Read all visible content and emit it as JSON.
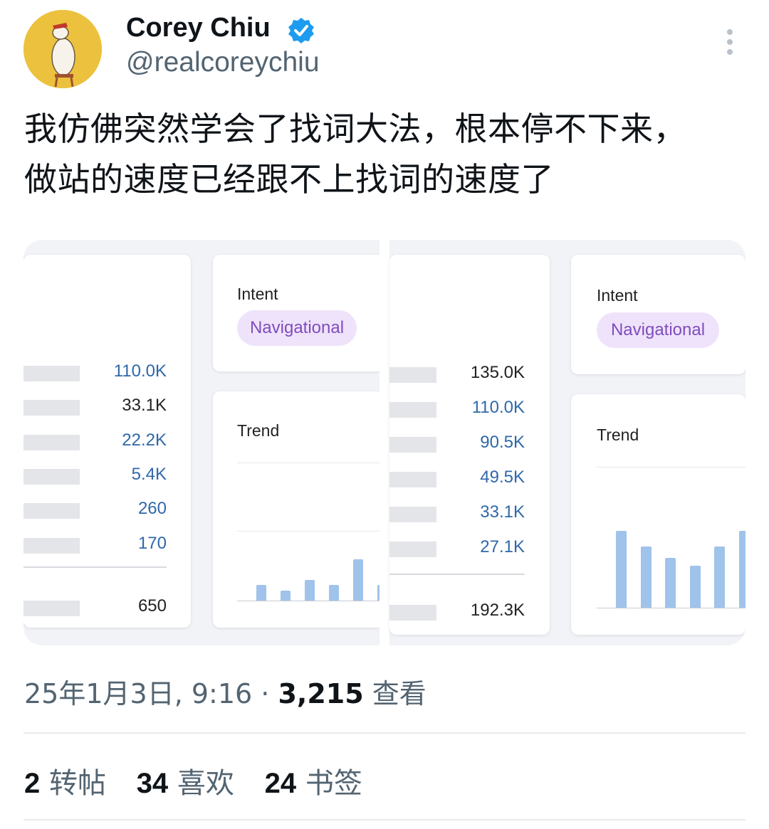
{
  "author": {
    "name": "Corey Chiu",
    "handle": "@realcoreychiu",
    "verified": true,
    "avatar_icon": "polar-bear-avatar-icon"
  },
  "tweet": {
    "lines": [
      "我仿佛突然学会了找词大法，根本停不下来，",
      "做站的速度已经跟不上找词的速度了"
    ]
  },
  "media": {
    "left_panel": {
      "intent_label": "Intent",
      "intent_value": "Navigational",
      "trend_label": "Trend",
      "rows": [
        "110.0K",
        "33.1K",
        "22.2K",
        "5.4K",
        "260",
        "170"
      ],
      "total": "650",
      "trend_values": [
        3,
        2,
        4,
        3,
        8,
        3
      ]
    },
    "right_panel": {
      "intent_label": "Intent",
      "intent_value": "Navigational",
      "trend_label": "Trend",
      "rows": [
        "135.0K",
        "110.0K",
        "90.5K",
        "49.5K",
        "33.1K",
        "27.1K"
      ],
      "total": "192.3K",
      "trend_values": [
        10,
        8,
        6.5,
        5.5,
        8,
        10
      ]
    },
    "colors": {
      "pill_bg": "#efe3fb",
      "pill_text": "#7f4dbd",
      "link_value": "#2f68aa",
      "trend_bar": "#9fc3ea"
    }
  },
  "meta": {
    "timestamp": "25年1月3日, 9:16",
    "separator": "·",
    "views": "3,215",
    "views_label": "查看"
  },
  "stats": {
    "retweets": "2",
    "retweets_label": "转帖",
    "likes": "34",
    "likes_label": "喜欢",
    "bookmarks": "24",
    "bookmarks_label": "书签"
  }
}
